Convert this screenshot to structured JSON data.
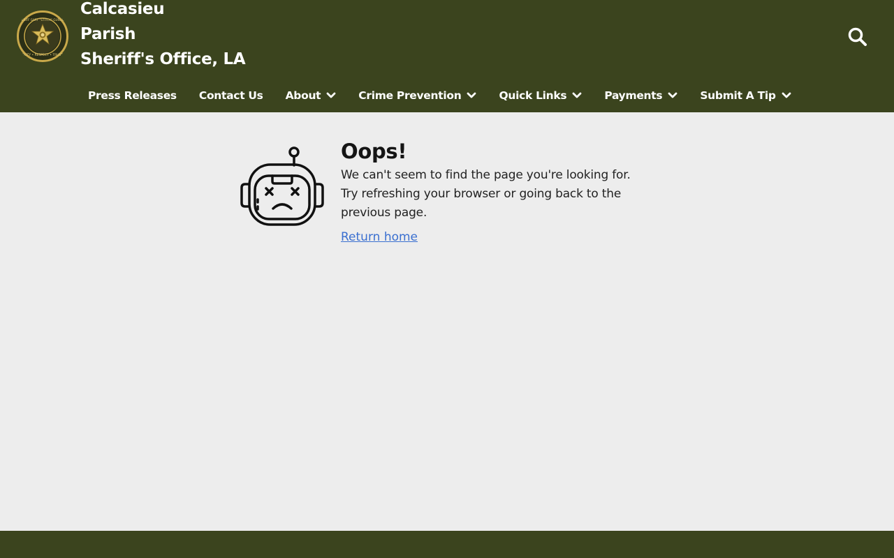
{
  "header": {
    "title_lines": [
      "Calcasieu",
      "Parish",
      "Sheriff's Office, LA"
    ],
    "seal": {
      "top_text": "SHERIFF GARY \"STITCH\" GUILLORY",
      "bottom_text": "DUTY • RESPECT • TRUST"
    },
    "search_icon": "search-icon"
  },
  "nav": {
    "items": [
      {
        "label": "Press Releases",
        "has_dropdown": false
      },
      {
        "label": "Contact Us",
        "has_dropdown": false
      },
      {
        "label": "About",
        "has_dropdown": true
      },
      {
        "label": "Crime Prevention",
        "has_dropdown": true
      },
      {
        "label": "Quick Links",
        "has_dropdown": true
      },
      {
        "label": "Payments",
        "has_dropdown": true
      },
      {
        "label": "Submit A Tip",
        "has_dropdown": true
      }
    ]
  },
  "error": {
    "title": "Oops!",
    "message_lines": [
      "We can't seem to find the page you're looking for.",
      "Try refreshing your browser or going back to the",
      "previous page."
    ],
    "return_link": "Return home",
    "icon": "sad-robot-icon"
  },
  "colors": {
    "header_bg": "#3b441e",
    "page_bg": "#ededed",
    "link": "#3a6fd0",
    "seal_gold": "#c9a94a"
  }
}
